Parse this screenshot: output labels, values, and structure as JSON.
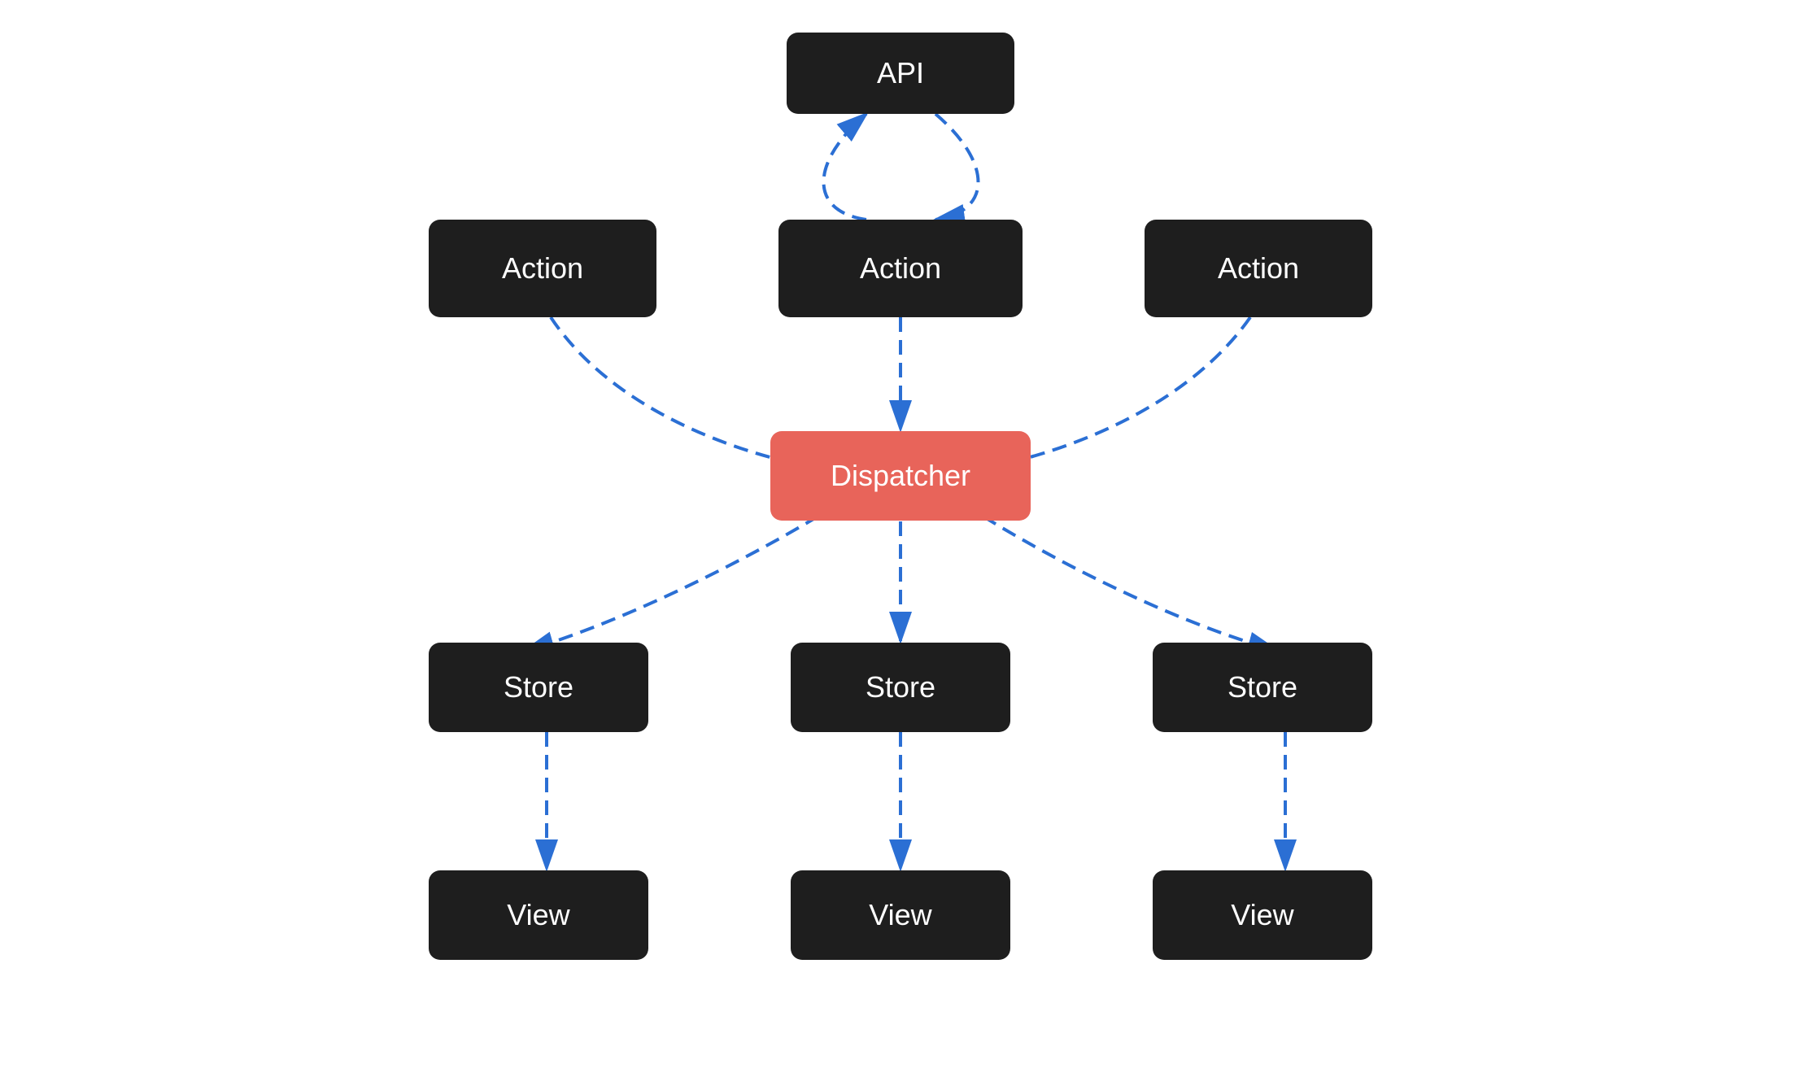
{
  "nodes": {
    "api": {
      "label": "API"
    },
    "action_left": {
      "label": "Action"
    },
    "action_center": {
      "label": "Action"
    },
    "action_right": {
      "label": "Action"
    },
    "dispatcher": {
      "label": "Dispatcher"
    },
    "store_left": {
      "label": "Store"
    },
    "store_center": {
      "label": "Store"
    },
    "store_right": {
      "label": "Store"
    },
    "view_left": {
      "label": "View"
    },
    "view_center": {
      "label": "View"
    },
    "view_right": {
      "label": "View"
    }
  },
  "colors": {
    "node_bg": "#1e1e1e",
    "dispatcher_bg": "#e8645a",
    "arrow": "#2b6fd4",
    "bg": "#ffffff"
  }
}
